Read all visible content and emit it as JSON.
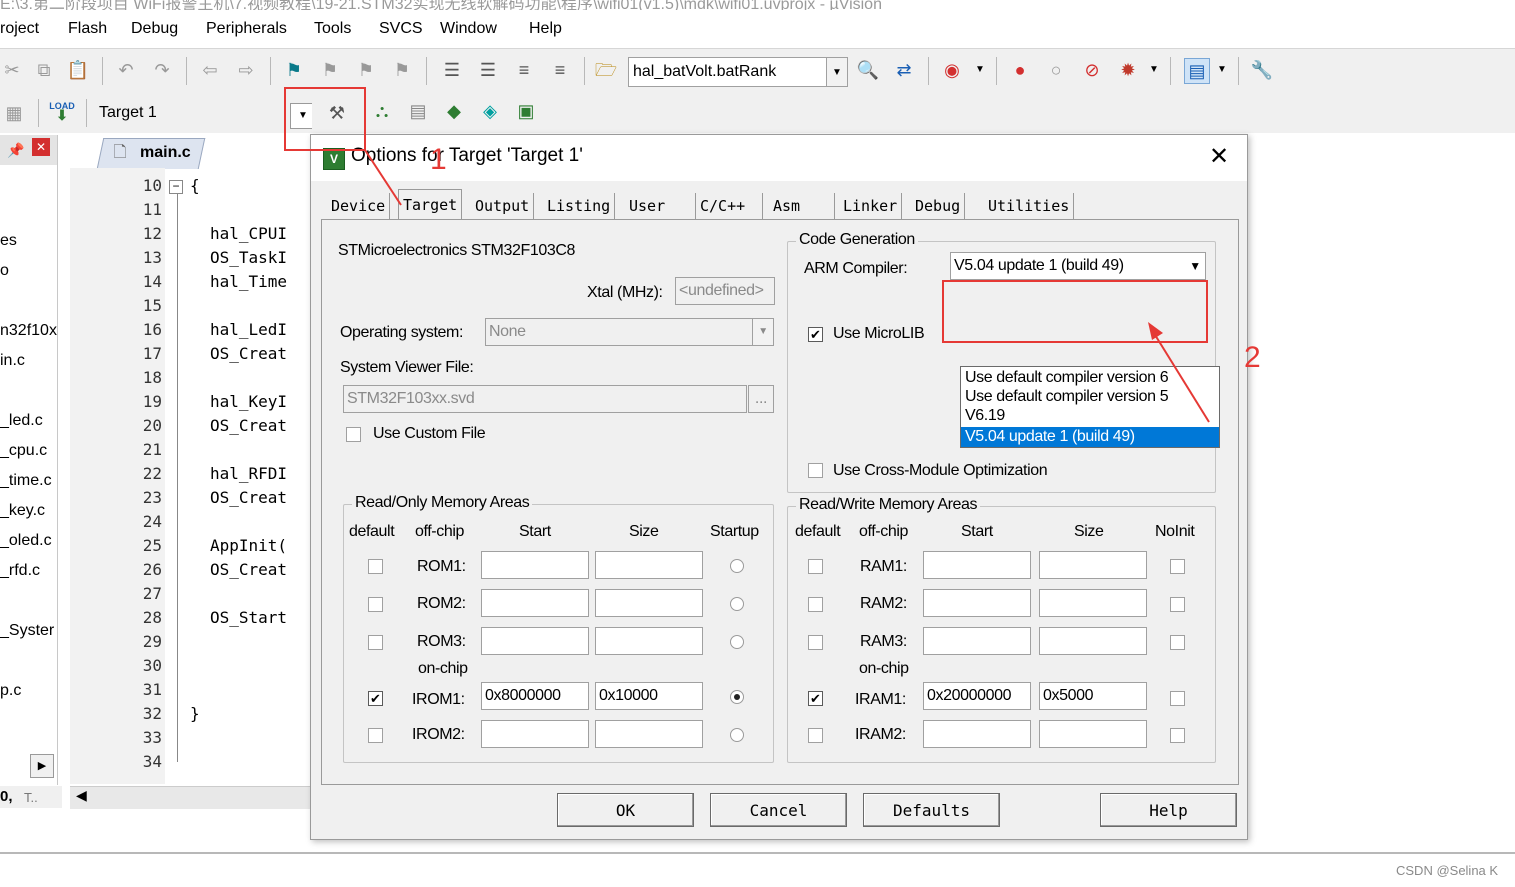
{
  "window": {
    "title_fragment": "E:\\3.第二阶段项目 WiFi报警主机\\7.视频教程\\19-21.STM32实现无线软解码功能\\程序\\wifi01(v1.5)\\mdk\\wifi01.uvprojx - µVision"
  },
  "menu": [
    "roject",
    "Flash",
    "Debug",
    "Peripherals",
    "Tools",
    "SVCS",
    "Window",
    "Help"
  ],
  "toolbar": {
    "find_combo_value": "hal_batVolt.batRank",
    "target_combo_value": "Target 1",
    "load_label": "LOAD"
  },
  "project_panel": {
    "items": [
      "es",
      "o",
      "n32f10x",
      "in.c",
      "_led.c",
      "_cpu.c",
      "_time.c",
      "_key.c",
      "_oled.c",
      "_rfd.c",
      "_Syster",
      "p.c"
    ],
    "bottom_tab": "T.."
  },
  "editor": {
    "tab": "main.c",
    "lines": [
      {
        "no": "10",
        "text": "{"
      },
      {
        "no": "11",
        "text": ""
      },
      {
        "no": "12",
        "text": "hal_CPUI"
      },
      {
        "no": "13",
        "text": "OS_TaskI"
      },
      {
        "no": "14",
        "text": "hal_Time"
      },
      {
        "no": "15",
        "text": ""
      },
      {
        "no": "16",
        "text": "hal_LedI"
      },
      {
        "no": "17",
        "text": "OS_Creat"
      },
      {
        "no": "18",
        "text": ""
      },
      {
        "no": "19",
        "text": "hal_KeyI"
      },
      {
        "no": "20",
        "text": "OS_Creat"
      },
      {
        "no": "21",
        "text": ""
      },
      {
        "no": "22",
        "text": "hal_RFDI"
      },
      {
        "no": "23",
        "text": "OS_Creat"
      },
      {
        "no": "24",
        "text": ""
      },
      {
        "no": "25",
        "text": "AppInit("
      },
      {
        "no": "26",
        "text": "OS_Creat"
      },
      {
        "no": "27",
        "text": ""
      },
      {
        "no": "28",
        "text": "OS_Start"
      },
      {
        "no": "29",
        "text": ""
      },
      {
        "no": "30",
        "text": ""
      },
      {
        "no": "31",
        "text": ""
      },
      {
        "no": "32",
        "text": "}"
      },
      {
        "no": "33",
        "text": ""
      },
      {
        "no": "34",
        "text": ""
      }
    ]
  },
  "dialog": {
    "title": "Options for Target 'Target 1'",
    "app_icon_text": "V",
    "tabs": [
      "Device",
      "Target",
      "Output",
      "Listing",
      "User",
      "C/C++",
      "Asm",
      "Linker",
      "Debug",
      "Utilities"
    ],
    "active_tab": "Target",
    "device_name": "STMicroelectronics STM32F103C8",
    "xtal_label": "Xtal (MHz):",
    "xtal_value": "<undefined>",
    "os_label": "Operating system:",
    "os_value": "None",
    "svd_label": "System Viewer File:",
    "svd_value": "STM32F103xx.svd",
    "svd_browse": "...",
    "custom_file_label": "Use Custom File",
    "code_gen": {
      "title": "Code Generation",
      "compiler_label": "ARM Compiler:",
      "compiler_value": "V5.04 update 1 (build 49)",
      "microlib_label": "Use MicroLIB",
      "cross_module_label": "Use Cross-Module Optimization",
      "dropdown_options": [
        "Use default compiler version 6",
        "Use default compiler version 5",
        "V6.19",
        "V5.04 update 1 (build 49)"
      ]
    },
    "ro_mem": {
      "title": "Read/Only Memory Areas",
      "headers": [
        "default",
        "off-chip",
        "Start",
        "Size",
        "Startup"
      ],
      "offchip_rows": [
        {
          "name": "ROM1:",
          "start": "",
          "size": ""
        },
        {
          "name": "ROM2:",
          "start": "",
          "size": ""
        },
        {
          "name": "ROM3:",
          "start": "",
          "size": ""
        }
      ],
      "onchip_label": "on-chip",
      "onchip_rows": [
        {
          "name": "IROM1:",
          "start": "0x8000000",
          "size": "0x10000"
        },
        {
          "name": "IROM2:",
          "start": "",
          "size": ""
        }
      ]
    },
    "rw_mem": {
      "title": "Read/Write Memory Areas",
      "headers": [
        "default",
        "off-chip",
        "Start",
        "Size",
        "NoInit"
      ],
      "offchip_rows": [
        {
          "name": "RAM1:",
          "start": "",
          "size": ""
        },
        {
          "name": "RAM2:",
          "start": "",
          "size": ""
        },
        {
          "name": "RAM3:",
          "start": "",
          "size": ""
        }
      ],
      "onchip_label": "on-chip",
      "onchip_rows": [
        {
          "name": "IRAM1:",
          "start": "0x20000000",
          "size": "0x5000"
        },
        {
          "name": "IRAM2:",
          "start": "",
          "size": ""
        }
      ]
    },
    "buttons": {
      "ok": "OK",
      "cancel": "Cancel",
      "defaults": "Defaults",
      "help": "Help"
    }
  },
  "annotations": {
    "step1": "1",
    "step2": "2",
    "color": "#e53935"
  },
  "watermark": "CSDN @Selina K"
}
